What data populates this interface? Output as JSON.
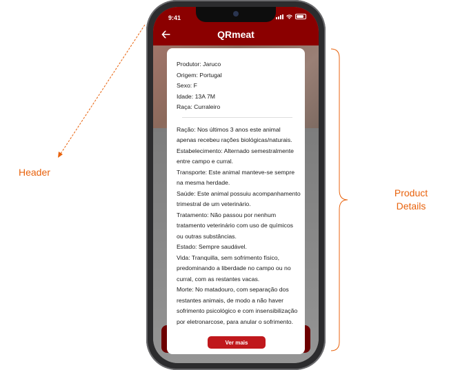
{
  "status_bar": {
    "time": "9:41"
  },
  "header": {
    "title": "QRmeat",
    "back_icon": "back-arrow-icon"
  },
  "product": {
    "basic": [
      "Produtor: Jaruco",
      "Origem: Portugal",
      "Sexo: F",
      "Idade: 13A 7M",
      "Raça: Curraleiro"
    ],
    "details": [
      "Ração: Nos últimos 3 anos este animal apenas recebeu rações biológicas/naturais.",
      "Estabelecimento: Alternado semestralmente entre campo e curral.",
      "Transporte: Este animal manteve-se sempre na mesma herdade.",
      "Saúde: Este animal possuiu acompanhamento trimestral de um veterinário.",
      "Tratamento: Não passou por nenhum tratamento veterinário com uso de químicos ou outras substâncias.",
      "Estado: Sempre saudável.",
      "Vida: Tranquilla, sem sofrimento físico, predominando a liberdade no campo ou no curral, com as restantes vacas.",
      "Morte: No matadouro, com separação dos restantes animais, de modo a não haver sofrimento psicológico e com insensibilização por eletronarcose, para anular o sofrimento."
    ],
    "button_label": "Ver mais"
  },
  "annotations": {
    "header": "Header",
    "product_details": "Product Details"
  },
  "colors": {
    "brand_red": "#8b0000",
    "button_red": "#c0181c",
    "annotation_orange": "#e8620c"
  }
}
